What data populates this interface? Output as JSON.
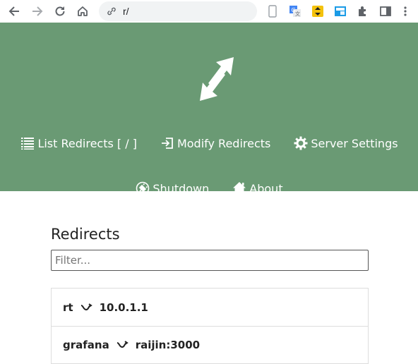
{
  "browser": {
    "url": "r/",
    "icons": [
      "back-icon",
      "forward-icon",
      "reload-icon",
      "home-icon",
      "site-info-icon",
      "device-icon",
      "translate-icon",
      "extension-icon",
      "extension-icon",
      "extensions-puzzle-icon",
      "side-panel-icon",
      "menu-icon"
    ]
  },
  "header": {
    "background": "#6a9a74",
    "nav": [
      {
        "label": "List Redirects [ / ]",
        "icon": "list-icon"
      },
      {
        "label": "Modify Redirects",
        "icon": "login-arrow-icon"
      },
      {
        "label": "Server Settings",
        "icon": "gear-icon"
      },
      {
        "label": "Shutdown",
        "icon": "power-plug-icon"
      },
      {
        "label": "About",
        "icon": "house-icon"
      }
    ]
  },
  "main": {
    "title": "Redirects",
    "filter": {
      "value": "",
      "placeholder": "Filter..."
    },
    "redirects": [
      {
        "from": "rt",
        "to": "10.0.1.1"
      },
      {
        "from": "grafana",
        "to": "raijin:3000"
      }
    ]
  }
}
